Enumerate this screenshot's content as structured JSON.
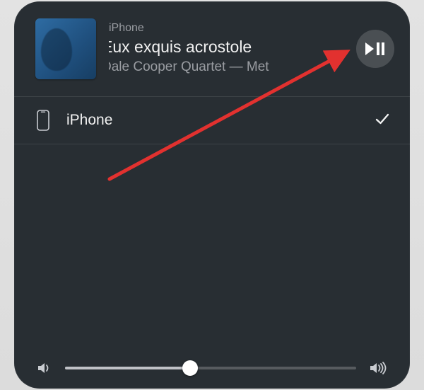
{
  "now_playing": {
    "source_device_label": "iPhone",
    "track_title": "Eux exquis acrostole",
    "track_artist": "Dale Cooper Quartet — Met"
  },
  "device_list": {
    "items": [
      {
        "label": "iPhone",
        "selected": true
      }
    ]
  },
  "volume": {
    "value_percent": 43
  },
  "annotation": {
    "arrow_color": "#e2312f"
  }
}
